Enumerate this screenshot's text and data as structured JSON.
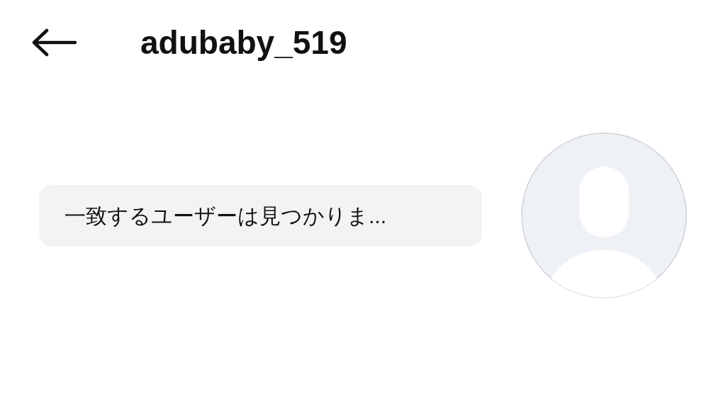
{
  "header": {
    "title": "adubaby_519"
  },
  "message": {
    "text": "一致するユーザーは見つかりま..."
  }
}
